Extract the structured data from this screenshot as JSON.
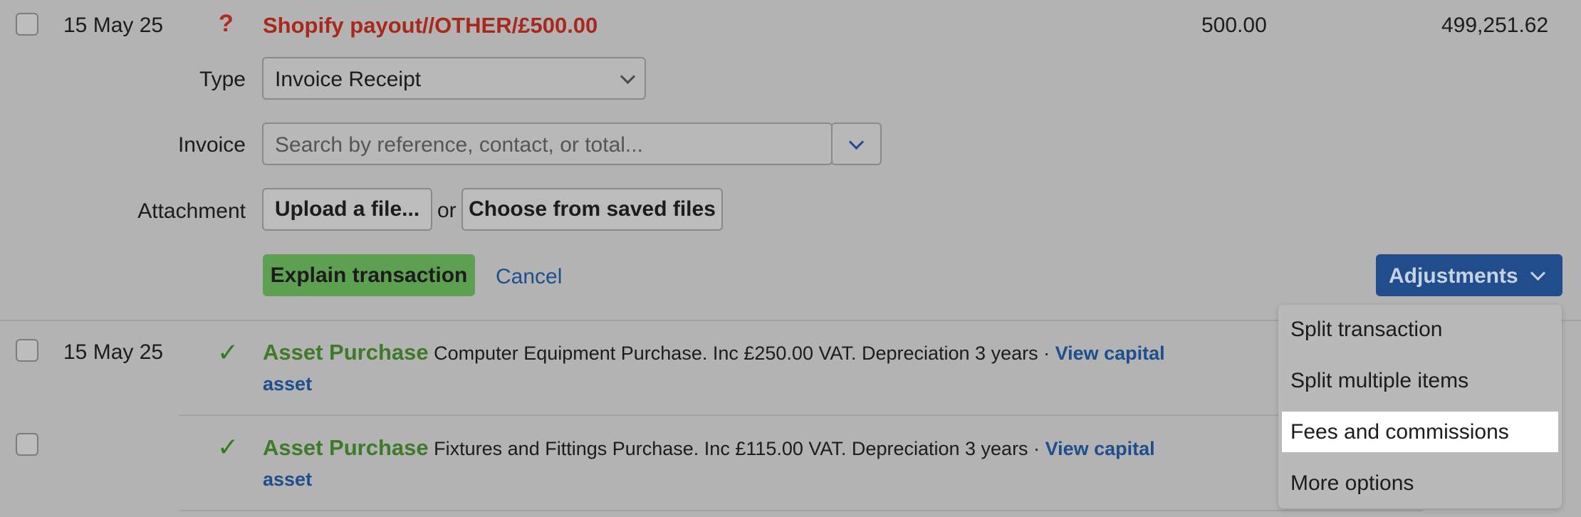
{
  "row1": {
    "date": "15 May 25",
    "status_icon": "question-icon",
    "description": "Shopify payout//OTHER/£500.00",
    "amount": "500.00",
    "balance": "499,251.62"
  },
  "form": {
    "type_label": "Type",
    "type_value": "Invoice Receipt",
    "invoice_label": "Invoice",
    "invoice_placeholder": "Search by reference, contact, or total...",
    "attachment_label": "Attachment",
    "upload_label": "Upload a file...",
    "or_text": "or",
    "choose_label": "Choose from saved files",
    "explain_label": "Explain transaction",
    "cancel_label": "Cancel",
    "adjustments_label": "Adjustments"
  },
  "adjustments_menu": {
    "items": [
      "Split transaction",
      "Split multiple items",
      "Fees and commissions",
      "More options"
    ],
    "highlighted": "Fees and commissions"
  },
  "row2": {
    "date": "15 May 25",
    "status_icon": "check-icon",
    "type": "Asset Purchase",
    "detail": "Computer Equipment Purchase. Inc £250.00 VAT. Depreciation 3 years ·",
    "link_part1": "View capital",
    "link_part2": "asset"
  },
  "row3": {
    "date": "",
    "status_icon": "check-icon",
    "type": "Asset Purchase",
    "detail": "Fixtures and Fittings Purchase. Inc £115.00 VAT. Depreciation 3 years ·",
    "link_part1": "View capital",
    "link_part2": "asset"
  },
  "colors": {
    "overlay_bg": "#b3b3b3",
    "unexplained_red": "#a8281d",
    "explained_green": "#3f7a2a",
    "link_blue": "#1f4e8c",
    "primary_button": "#214d8c",
    "explain_button": "#5ea052"
  }
}
